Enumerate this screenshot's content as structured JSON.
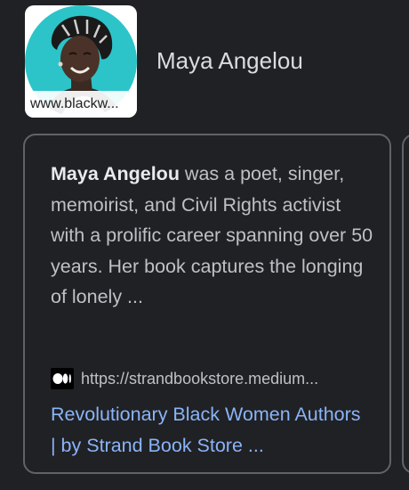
{
  "entity": {
    "name": "Maya Angelou",
    "thumbnail_caption": "www.blackw..."
  },
  "card": {
    "snippet_bold": "Maya Angelou",
    "snippet_rest": " was a poet, singer, memoirist, and Civil Rights activist with a prolific career spanning over 50 years. Her book captures the longing of lonely ...",
    "source_icon": "medium-logo-icon",
    "source_url": "https://strandbookstore.medium...",
    "title": "Revolutionary Black Women Authors | by Strand Book Store ..."
  },
  "colors": {
    "background": "#202124",
    "link": "#8ab4f8",
    "thumbnail_accent": "#2cc4c8",
    "card_border": "#5f6368"
  }
}
